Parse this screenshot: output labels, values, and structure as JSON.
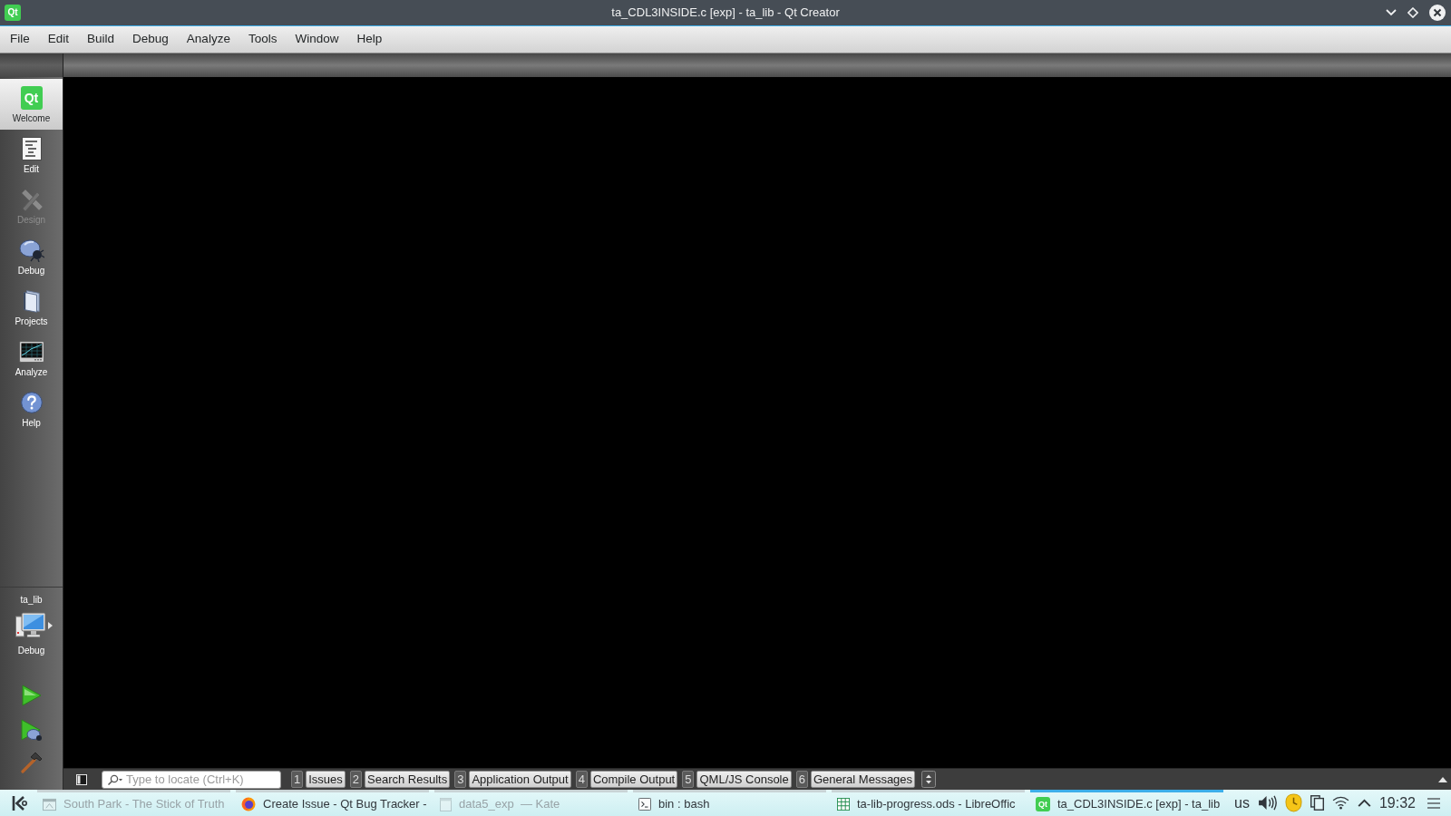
{
  "window": {
    "logo": "Qt",
    "title": "ta_CDL3INSIDE.c [exp] - ta_lib - Qt Creator"
  },
  "menu": [
    "File",
    "Edit",
    "Build",
    "Debug",
    "Analyze",
    "Tools",
    "Window",
    "Help"
  ],
  "modes": [
    {
      "label": "Welcome",
      "logo": "Qt",
      "selected": true,
      "disabled": false
    },
    {
      "label": "Edit",
      "selected": false,
      "disabled": false
    },
    {
      "label": "Design",
      "selected": false,
      "disabled": true
    },
    {
      "label": "Debug",
      "selected": false,
      "disabled": false
    },
    {
      "label": "Projects",
      "selected": false,
      "disabled": false
    },
    {
      "label": "Analyze",
      "selected": false,
      "disabled": false
    },
    {
      "label": "Help",
      "selected": false,
      "disabled": false
    }
  ],
  "kit": {
    "project": "ta_lib",
    "build": "Debug"
  },
  "output_bar": {
    "locate": {
      "placeholder": "Type to locate (Ctrl+K)"
    },
    "panes": [
      {
        "number": "1",
        "label": "Issues"
      },
      {
        "number": "2",
        "label": "Search Results"
      },
      {
        "number": "3",
        "label": "Application Output"
      },
      {
        "number": "4",
        "label": "Compile Output"
      },
      {
        "number": "5",
        "label": "QML/JS Console"
      },
      {
        "number": "6",
        "label": "General Messages"
      }
    ]
  },
  "taskbar": {
    "tasks": [
      {
        "title": "South Park - The Stick of Truth",
        "minimized": true,
        "selected": false
      },
      {
        "title": "Create Issue - Qt Bug Tracker -",
        "minimized": false,
        "selected": false
      },
      {
        "title": "data5_exp  — Kate",
        "minimized": true,
        "selected": false
      },
      {
        "title": "bin : bash",
        "minimized": false,
        "selected": false
      },
      {
        "title": "ta-lib-progress.ods - LibreOffic",
        "minimized": false,
        "selected": false
      },
      {
        "title": "ta_CDL3INSIDE.c [exp] - ta_lib",
        "logo": "Qt",
        "minimized": false,
        "selected": true
      }
    ],
    "tray": {
      "layout": "us",
      "clock": "19:32"
    }
  }
}
